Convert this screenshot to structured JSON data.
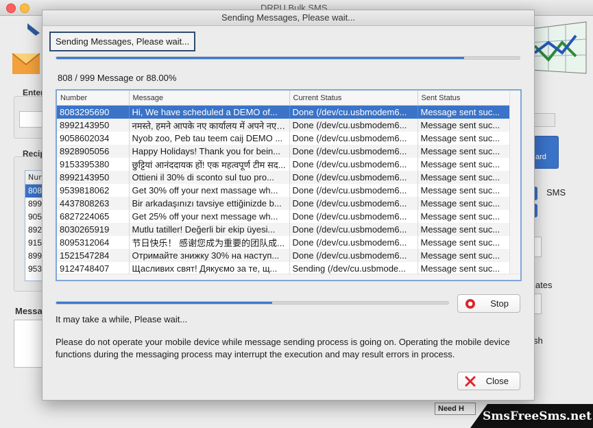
{
  "background_app": {
    "title": "DRPU Bulk SMS",
    "enter_label": "Enter",
    "recipient_label": "Recip",
    "list_header": "Nur",
    "list_cells": [
      "808",
      "899",
      "905",
      "892",
      "915",
      "899",
      "953"
    ],
    "message_label": "Messa",
    "right_button_text": "ard",
    "sms_label": "SMS",
    "plates_label": "lates",
    "sh_label": "sh",
    "need_help_label": "Need H"
  },
  "watermark": "SmsFreeSms.net",
  "modal": {
    "title": "Sending Messages, Please wait...",
    "status_box": "Sending Messages, Please wait...",
    "overall_progress": 0.88,
    "progress_text": "808 / 999 Message or 88.00%",
    "table": {
      "columns": [
        "Number",
        "Message",
        "Current Status",
        "Sent Status"
      ],
      "rows": [
        [
          "8083295690",
          "Hi, We have scheduled a DEMO of...",
          "Done (/dev/cu.usbmodem6...",
          "Message sent suc..."
        ],
        [
          "8992143950",
          "नमस्ते, हमने आपके नए कार्यालय में अपने नए ...",
          "Done (/dev/cu.usbmodem6...",
          "Message sent suc..."
        ],
        [
          "9058602034",
          "Nyob zoo, Peb tau teem caij DEMO ...",
          "Done (/dev/cu.usbmodem6...",
          "Message sent suc..."
        ],
        [
          "8928905056",
          "Happy Holidays! Thank you for bein...",
          "Done (/dev/cu.usbmodem6...",
          "Message sent suc..."
        ],
        [
          "9153395380",
          "छुट्टियां आनंददायक हों! एक महत्वपूर्ण टीम सद...",
          "Done (/dev/cu.usbmodem6...",
          "Message sent suc..."
        ],
        [
          "8992143950",
          "Ottieni il 30% di sconto sul tuo pro...",
          "Done (/dev/cu.usbmodem6...",
          "Message sent suc..."
        ],
        [
          "9539818062",
          "Get 30% off your next massage wh...",
          "Done (/dev/cu.usbmodem6...",
          "Message sent suc..."
        ],
        [
          "4437808263",
          "Bir arkadaşınızı tavsiye ettiğinizde b...",
          "Done (/dev/cu.usbmodem6...",
          "Message sent suc..."
        ],
        [
          "6827224065",
          "Get 25% off your next message wh...",
          "Done (/dev/cu.usbmodem6...",
          "Message sent suc..."
        ],
        [
          "8030265919",
          "Mutlu tatiller! Değerli bir ekip üyesi...",
          "Done (/dev/cu.usbmodem6...",
          "Message sent suc..."
        ],
        [
          "8095312064",
          "节日快乐！ 感谢您成为重要的团队成...",
          "Done (/dev/cu.usbmodem6...",
          "Message sent suc..."
        ],
        [
          "1521547284",
          "Отримайте знижку 30% на наступ...",
          "Done (/dev/cu.usbmodem6...",
          "Message sent suc..."
        ],
        [
          "9124748407",
          "Щасливих свят! Дякуємо за те, щ...",
          "Sending (/dev/cu.usbmode...",
          "Message sent suc..."
        ]
      ],
      "selected_row": 0
    },
    "current_progress": 0.55,
    "stop_label": "Stop",
    "wait_text": "It may take a while, Please wait...",
    "warning_text": "Please do not operate your mobile device while message sending process is going on. Operating the mobile device functions during the messaging process may interrupt the execution and may result errors in process.",
    "close_label": "Close",
    "colors": {
      "accent": "#3a73c8",
      "stop_icon": "#d9262c",
      "close_icon": "#d9262c"
    }
  }
}
